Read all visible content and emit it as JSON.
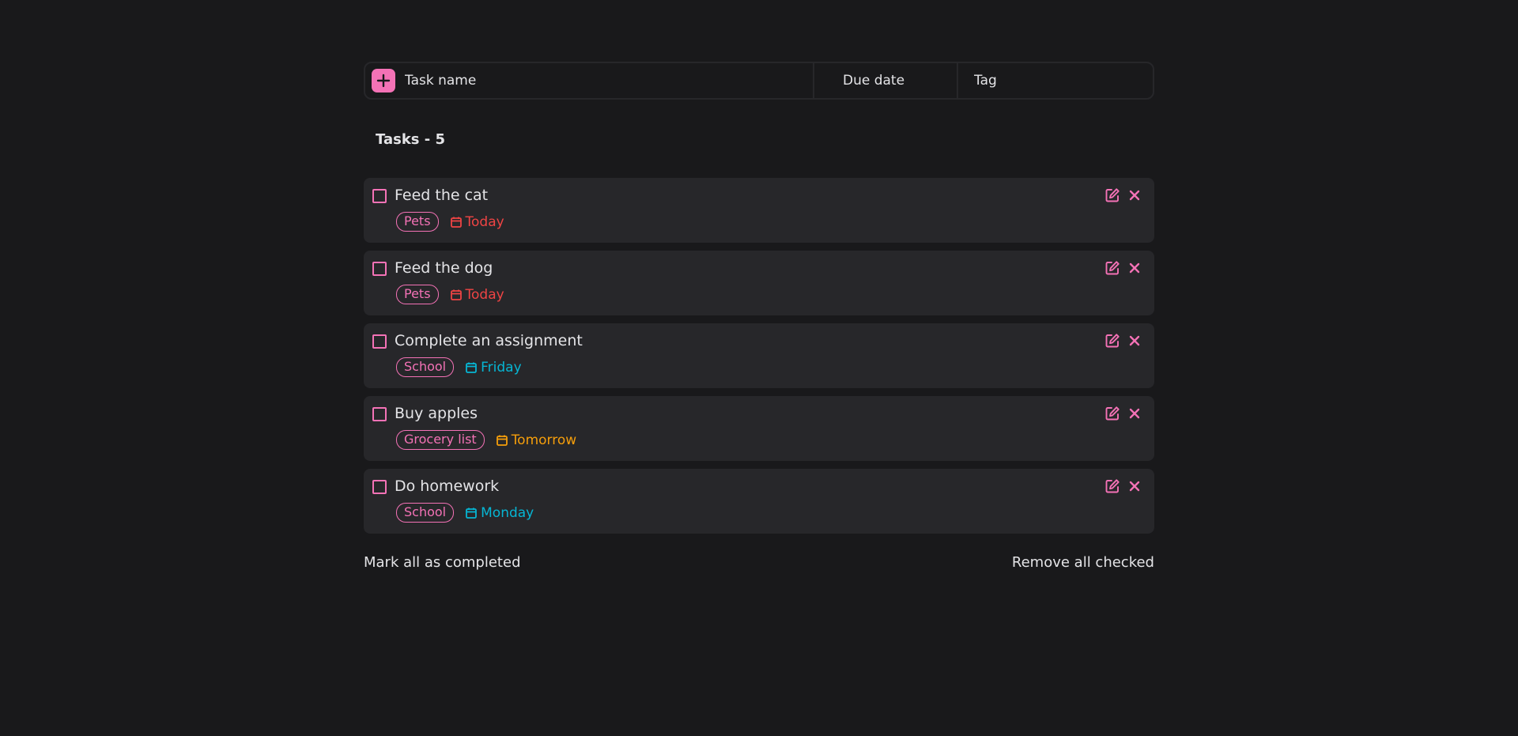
{
  "colors": {
    "background": "#19191b",
    "card": "#27272a",
    "accent": "#f472b6",
    "due_today": "#ef4444",
    "due_week": "#06b6d4",
    "due_tomorrow": "#f59e0b"
  },
  "add_bar": {
    "add_icon": "plus-icon",
    "task_name_placeholder": "Task name",
    "due_date_placeholder": "Due date",
    "tag_placeholder": "Tag"
  },
  "tasks_header": "Tasks - 5",
  "tasks": [
    {
      "title": "Feed the cat",
      "tag": "Pets",
      "due": "Today",
      "due_color": "#ef4444"
    },
    {
      "title": "Feed the dog",
      "tag": "Pets",
      "due": "Today",
      "due_color": "#ef4444"
    },
    {
      "title": "Complete an assignment",
      "tag": "School",
      "due": "Friday",
      "due_color": "#06b6d4"
    },
    {
      "title": "Buy apples",
      "tag": "Grocery list",
      "due": "Tomorrow",
      "due_color": "#f59e0b"
    },
    {
      "title": "Do homework",
      "tag": "School",
      "due": "Monday",
      "due_color": "#06b6d4"
    }
  ],
  "footer": {
    "mark_all": "Mark all as completed",
    "remove_checked": "Remove all checked"
  }
}
